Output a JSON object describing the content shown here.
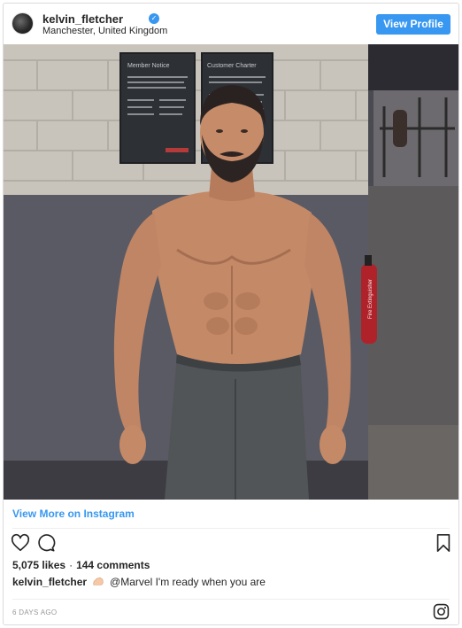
{
  "header": {
    "username": "kelvin_fletcher",
    "verified": true,
    "location": "Manchester, United Kingdom",
    "view_profile_label": "View Profile"
  },
  "photo": {
    "sign1_title": "Member Notice",
    "sign2_title": "Customer Charter",
    "extinguisher_text": "Fire Extinguisher"
  },
  "footer": {
    "view_more_label": "View More on Instagram",
    "likes_count": "5,075 likes",
    "comments_count": "144 comments",
    "caption_user": "kelvin_fletcher",
    "caption_mention": "@Marvel",
    "caption_text": "I'm ready when you are",
    "timestamp": "6 DAYS AGO"
  },
  "icons": {
    "like": "heart-icon",
    "comment": "comment-icon",
    "save": "bookmark-icon",
    "instagram": "instagram-logo-icon",
    "verified": "verified-badge-icon",
    "emoji": "flexed-biceps-emoji-icon"
  },
  "colors": {
    "accent": "#3897f0",
    "text": "#262626",
    "muted": "#999999",
    "border": "#dbdbdb"
  }
}
